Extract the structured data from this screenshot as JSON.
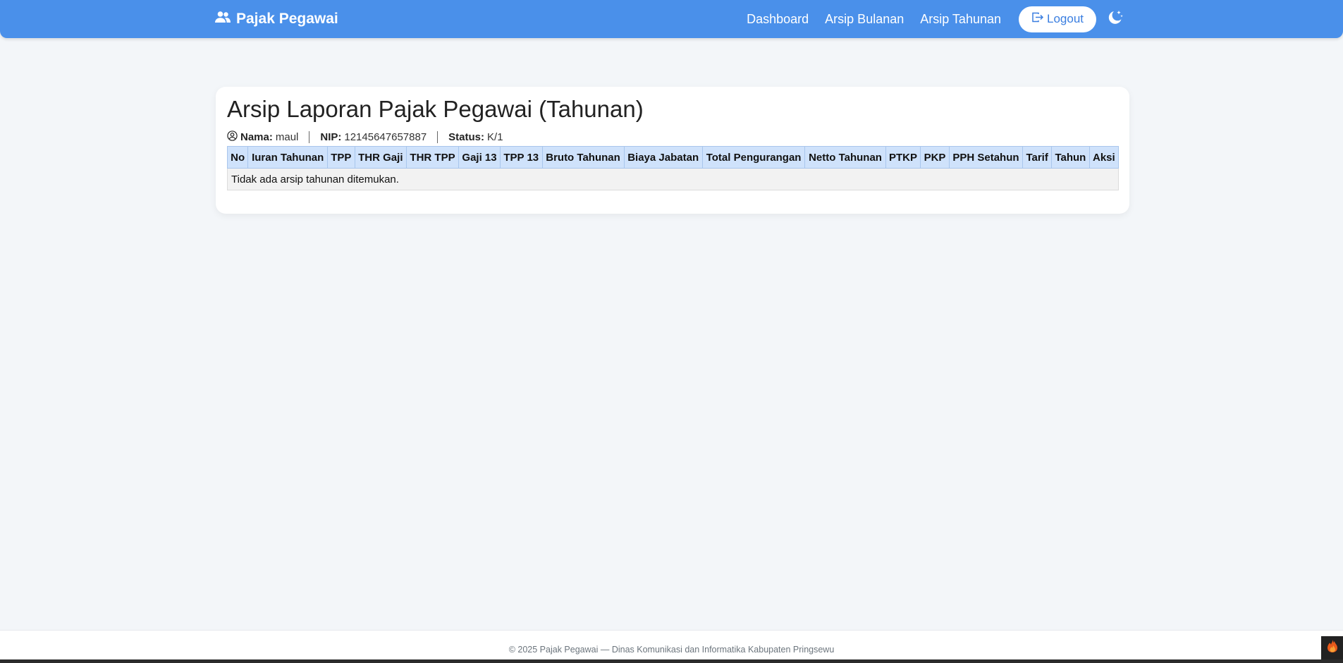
{
  "navbar": {
    "brand": "Pajak Pegawai",
    "links": [
      "Dashboard",
      "Arsip Bulanan",
      "Arsip Tahunan"
    ],
    "logout_label": "Logout",
    "accent": "#4a90ea"
  },
  "page": {
    "title": "Arsip Laporan Pajak Pegawai (Tahunan)",
    "meta": {
      "nama_label": "Nama:",
      "nama_value": "maul",
      "nip_label": "NIP:",
      "nip_value": "12145647657887",
      "status_label": "Status:",
      "status_value": "K/1"
    }
  },
  "table": {
    "columns": [
      "No",
      "Iuran Tahunan",
      "TPP",
      "THR Gaji",
      "THR TPP",
      "Gaji 13",
      "TPP 13",
      "Bruto Tahunan",
      "Biaya Jabatan",
      "Total Pengurangan",
      "Netto Tahunan",
      "PTKP",
      "PKP",
      "PPH Setahun",
      "Tarif",
      "Tahun",
      "Aksi"
    ],
    "empty_message": "Tidak ada arsip tahunan ditemukan.",
    "header_color": "#cfe2fb"
  },
  "footer": {
    "text": "© 2025 Pajak Pegawai — Dinas Komunikasi dan Informatika Kabupaten Pringsewu"
  },
  "icons": {
    "brand": "users-icon",
    "logout": "logout-icon",
    "theme": "moon-stars-icon",
    "profile": "user-circle-icon",
    "corner": "flame-icon"
  }
}
